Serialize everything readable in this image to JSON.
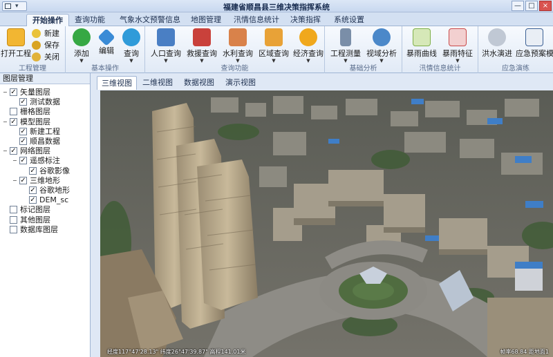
{
  "window": {
    "title": "福建省顺昌县三维决策指挥系统",
    "min": "—",
    "max": "□",
    "close": "×"
  },
  "menu_tabs": [
    "开始操作",
    "查询功能",
    "气象水文预警信息",
    "地图管理",
    "汛情信息统计",
    "决策指挥",
    "系统设置"
  ],
  "ribbon": {
    "project": {
      "open": "打开工程",
      "new": "新建",
      "save": "保存",
      "close": "关闭",
      "group": "工程管理"
    },
    "basic": {
      "add": "添加",
      "edit": "编辑",
      "query": "查询",
      "group": "基本操作"
    },
    "query": {
      "population": "人口查询",
      "rescue": "救援查询",
      "water": "水利查询",
      "region": "区域查询",
      "economy": "经济查询",
      "group": "查询功能"
    },
    "analysis": {
      "survey": "工程测量",
      "viewshed": "视域分析",
      "group": "基础分析"
    },
    "flood": {
      "rain_curve": "暴雨曲线",
      "rain_feature": "暴雨特征",
      "group": "汛情信息统计"
    },
    "emergency": {
      "flood_sim": "洪水演进",
      "plan": "应急预案模",
      "group": "应急演练"
    }
  },
  "layer_panel": {
    "title": "图层管理",
    "nodes": [
      {
        "label": "矢量图层",
        "checked": true,
        "expand": "−",
        "level": 0
      },
      {
        "label": "测试数据",
        "checked": true,
        "expand": "",
        "level": 1
      },
      {
        "label": "栅格图层",
        "checked": false,
        "expand": "",
        "level": 0
      },
      {
        "label": "模型图层",
        "checked": true,
        "expand": "−",
        "level": 0
      },
      {
        "label": "新建工程",
        "checked": true,
        "expand": "",
        "level": 1
      },
      {
        "label": "顺昌数据",
        "checked": true,
        "expand": "",
        "level": 1
      },
      {
        "label": "网络图层",
        "checked": true,
        "expand": "−",
        "level": 0
      },
      {
        "label": "遥感标注",
        "checked": true,
        "expand": "−",
        "level": 1
      },
      {
        "label": "谷歌影像",
        "checked": true,
        "expand": "",
        "level": 2
      },
      {
        "label": "三维地形",
        "checked": true,
        "expand": "−",
        "level": 1
      },
      {
        "label": "谷歌地形",
        "checked": true,
        "expand": "",
        "level": 2
      },
      {
        "label": "DEM_sc",
        "checked": true,
        "expand": "",
        "level": 2
      },
      {
        "label": "标记图层",
        "checked": false,
        "expand": "",
        "level": 0
      },
      {
        "label": "其他图层",
        "checked": false,
        "expand": "",
        "level": 0
      },
      {
        "label": "数据库图层",
        "checked": false,
        "expand": "",
        "level": 0
      }
    ]
  },
  "view_tabs": [
    "三维视图",
    "二维视图",
    "数据视图",
    "演示视图"
  ],
  "status": {
    "left": "经度117°47'28.13\"  纬度26°47'39.87\"  高程141.01米",
    "right": "帧率68.84  距地面1"
  },
  "colors": {
    "accent": "#2c6fc0",
    "ribbon_bg": "#e1eaf6"
  }
}
